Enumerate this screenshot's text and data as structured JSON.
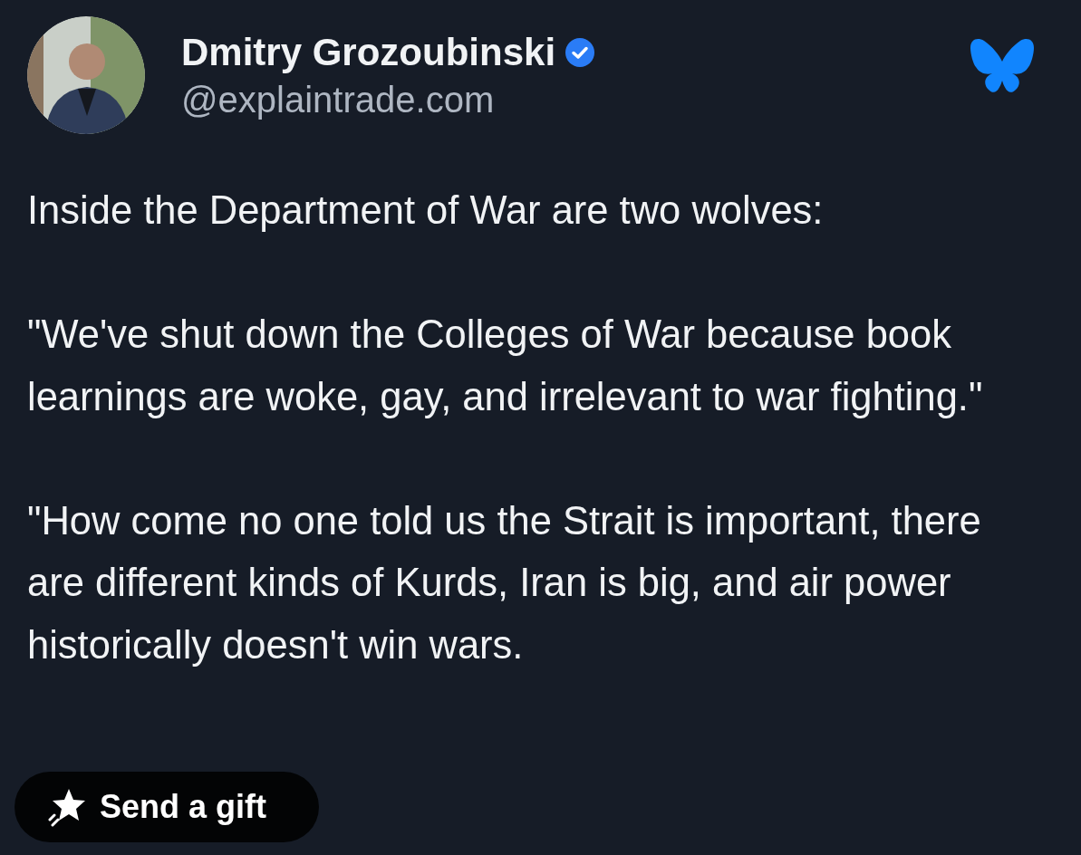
{
  "post": {
    "author": {
      "name": "Dmitry Grozoubinski",
      "verified": true,
      "handle": "@explaintrade.com"
    },
    "paragraphs": [
      "Inside the Department of War are two wolves:",
      "\"We've shut down the Colleges of War because book learnings are woke, gay, and irrelevant to war fighting.\"",
      "\"How come no one told us the Strait is important, there are different kinds of Kurds, Iran is big, and air power historically doesn't win wars."
    ]
  },
  "gift_button": {
    "label": "Send a gift"
  }
}
